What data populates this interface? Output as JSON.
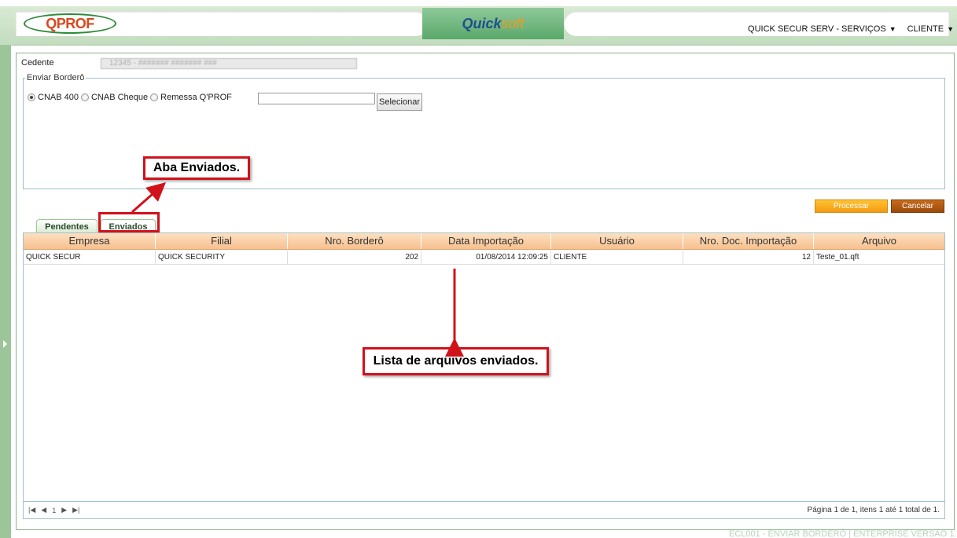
{
  "header": {
    "logo_text": "QPROF",
    "brand_part1": "Quick",
    "brand_part2": "soft",
    "menu_company": "QUICK SECUR SERV - SERVIÇOS",
    "menu_user": "CLIENTE"
  },
  "form": {
    "cedente_label": "Cedente",
    "cedente_value": "12345 - ####### ####### ###",
    "fieldset_legend": "Enviar Borderô",
    "radio_options": [
      "CNAB 400",
      "CNAB Cheque",
      "Remessa Q'PROF"
    ],
    "selected_option": "CNAB 400",
    "file_value": "",
    "select_button": "Selecionar"
  },
  "actions": {
    "process_label": "Processar",
    "cancel_label": "Cancelar"
  },
  "tabs": [
    {
      "label": "Pendentes",
      "active": false
    },
    {
      "label": "Enviados",
      "active": true
    }
  ],
  "grid": {
    "columns": [
      "Empresa",
      "Filial",
      "Nro. Borderô",
      "Data Importação",
      "Usuário",
      "Nro. Doc. Importação",
      "Arquivo"
    ],
    "rows": [
      {
        "empresa": "QUICK SECUR",
        "filial": "QUICK SECURITY",
        "bordero": "202",
        "data": "01/08/2014 12:09:25",
        "usuario": "CLIENTE",
        "doc": "12",
        "arquivo": "Teste_01.qft"
      }
    ],
    "pager_current": "1",
    "pager_summary": "Página 1 de 1, itens 1 até 1 total de 1."
  },
  "annotations": {
    "tab_callout": "Aba Enviados.",
    "list_callout": "Lista de arquivos enviados."
  },
  "footer": "ECL001 - ENVIAR BORDERÔ | ENTERPRISE VERSÃO 1.0.2.6",
  "colors": {
    "accent_green": "#9cc59a",
    "process_orange": "#f39a10",
    "cancel_brown": "#9c4a0c",
    "annotation_red": "#d0121b"
  }
}
